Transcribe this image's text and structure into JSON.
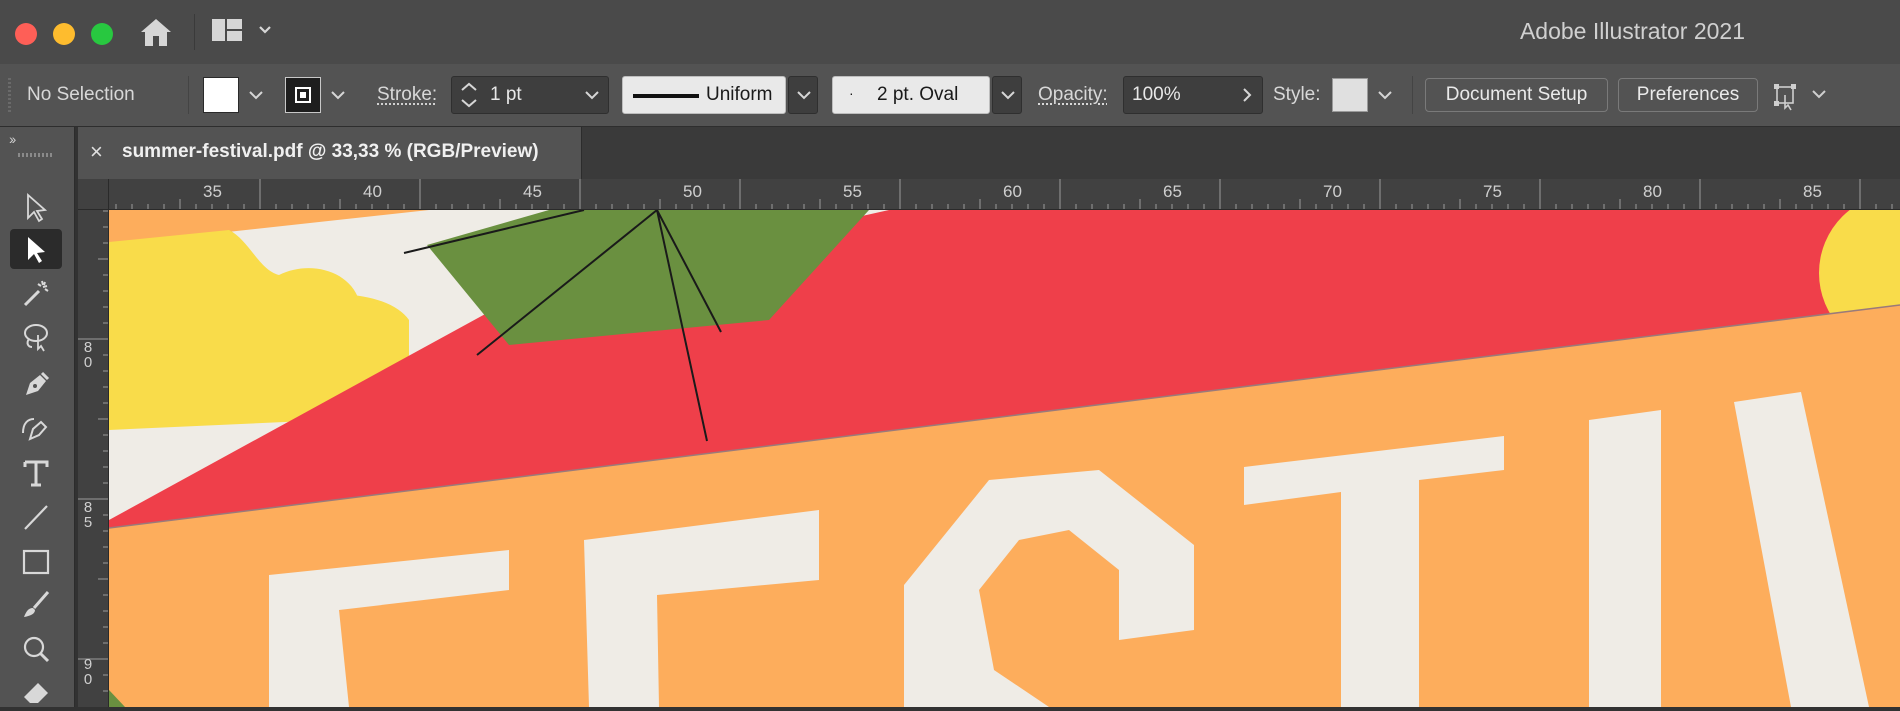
{
  "app": {
    "title": "Adobe Illustrator 2021"
  },
  "control_bar": {
    "selection_status": "No Selection",
    "stroke_label": "Stroke:",
    "stroke_weight": "1 pt",
    "stroke_profile": "Uniform",
    "brush": "2 pt. Oval",
    "opacity_label": "Opacity:",
    "opacity_value": "100%",
    "style_label": "Style:",
    "document_setup_button": "Document Setup",
    "preferences_button": "Preferences"
  },
  "document_tab": {
    "title": "summer-festival.pdf @ 33,33 % (RGB/Preview)",
    "close_glyph": "×"
  },
  "tools_panel": {
    "collapse_glyph": "››",
    "tools": [
      "selection-tool",
      "direct-selection-tool",
      "magic-wand-tool",
      "lasso-tool",
      "pen-tool",
      "curvature-tool",
      "type-tool",
      "line-segment-tool",
      "rectangle-tool",
      "paintbrush-tool",
      "shaper-tool",
      "eraser-tool"
    ],
    "active_tool": "direct-selection-tool"
  },
  "rulers": {
    "horizontal_labels": [
      "35",
      "40",
      "45",
      "50",
      "55",
      "60",
      "65",
      "70",
      "75",
      "80",
      "85"
    ],
    "vertical_labels": [
      [
        "8",
        "0"
      ],
      [
        "8",
        "5"
      ],
      [
        "9",
        "0"
      ]
    ]
  },
  "colors": {
    "artwork_red": "#ef3f4a",
    "artwork_orange": "#fdad5c",
    "artwork_green": "#6a9040",
    "artwork_yellow": "#f9dc4a",
    "artwork_cream": "#efece6"
  }
}
